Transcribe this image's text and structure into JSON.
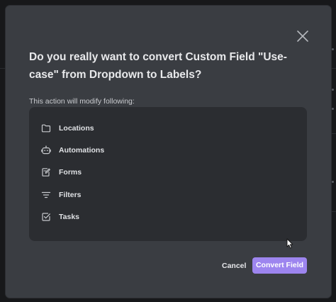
{
  "dialog": {
    "title": "Do you really want to convert Custom Field \"Use-case\" from Dropdown to Labels?",
    "subtitle": "This action will modify following:",
    "items": [
      {
        "label": "Locations",
        "icon": "folder-icon"
      },
      {
        "label": "Automations",
        "icon": "robot-icon"
      },
      {
        "label": "Forms",
        "icon": "form-edit-icon"
      },
      {
        "label": "Filters",
        "icon": "filter-icon"
      },
      {
        "label": "Tasks",
        "icon": "checkbox-icon"
      }
    ],
    "cancel_label": "Cancel",
    "confirm_label": "Convert Field",
    "close_icon": "close-icon"
  },
  "colors": {
    "modal_bg": "#3a3d42",
    "panel_bg": "#2b2d31",
    "accent": "#9d85ef",
    "text": "#e8e9eb"
  }
}
